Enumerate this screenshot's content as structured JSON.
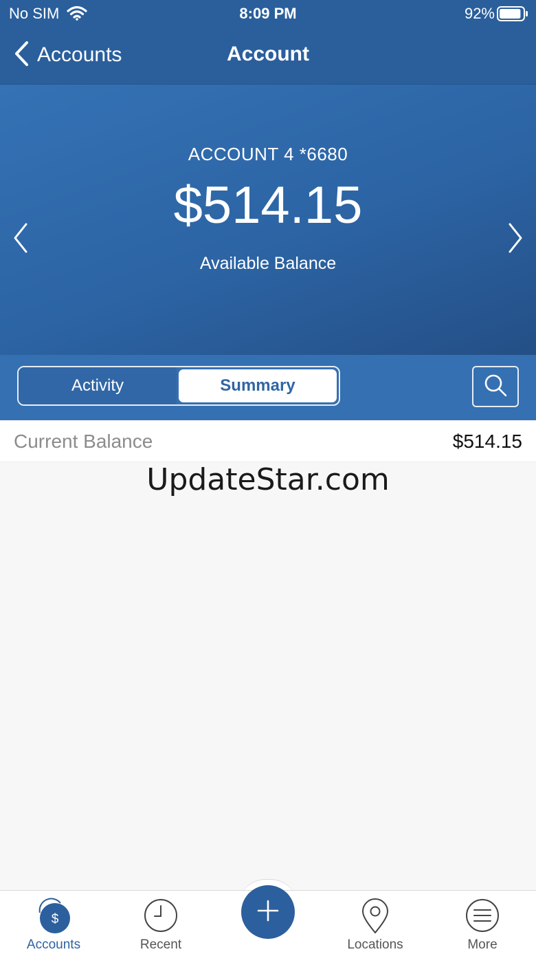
{
  "status": {
    "carrier": "No SIM",
    "time": "8:09 PM",
    "battery": "92%",
    "battery_level": 0.92
  },
  "nav": {
    "back_label": "Accounts",
    "title": "Account"
  },
  "account": {
    "name": "ACCOUNT 4 *6680",
    "balance": "$514.15",
    "balance_label": "Available Balance"
  },
  "segments": {
    "activity": "Activity",
    "summary": "Summary",
    "selected": "Summary"
  },
  "summary_rows": [
    {
      "label": "Current Balance",
      "value": "$514.15"
    }
  ],
  "watermark": "UpdateStar.com",
  "tabs": [
    {
      "label": "Accounts",
      "icon": "accounts-dollar-icon",
      "selected": true
    },
    {
      "label": "Recent",
      "icon": "clock-icon",
      "selected": false
    },
    {
      "label": "",
      "icon": "plus-icon",
      "selected": false
    },
    {
      "label": "Locations",
      "icon": "location-pin-icon",
      "selected": false
    },
    {
      "label": "More",
      "icon": "menu-icon",
      "selected": false
    }
  ],
  "colors": {
    "nav_bg": "#2a5f9c",
    "hero_bg": "#3472b5",
    "segment_bar": "#3570b2",
    "accent": "#2d63a2"
  }
}
